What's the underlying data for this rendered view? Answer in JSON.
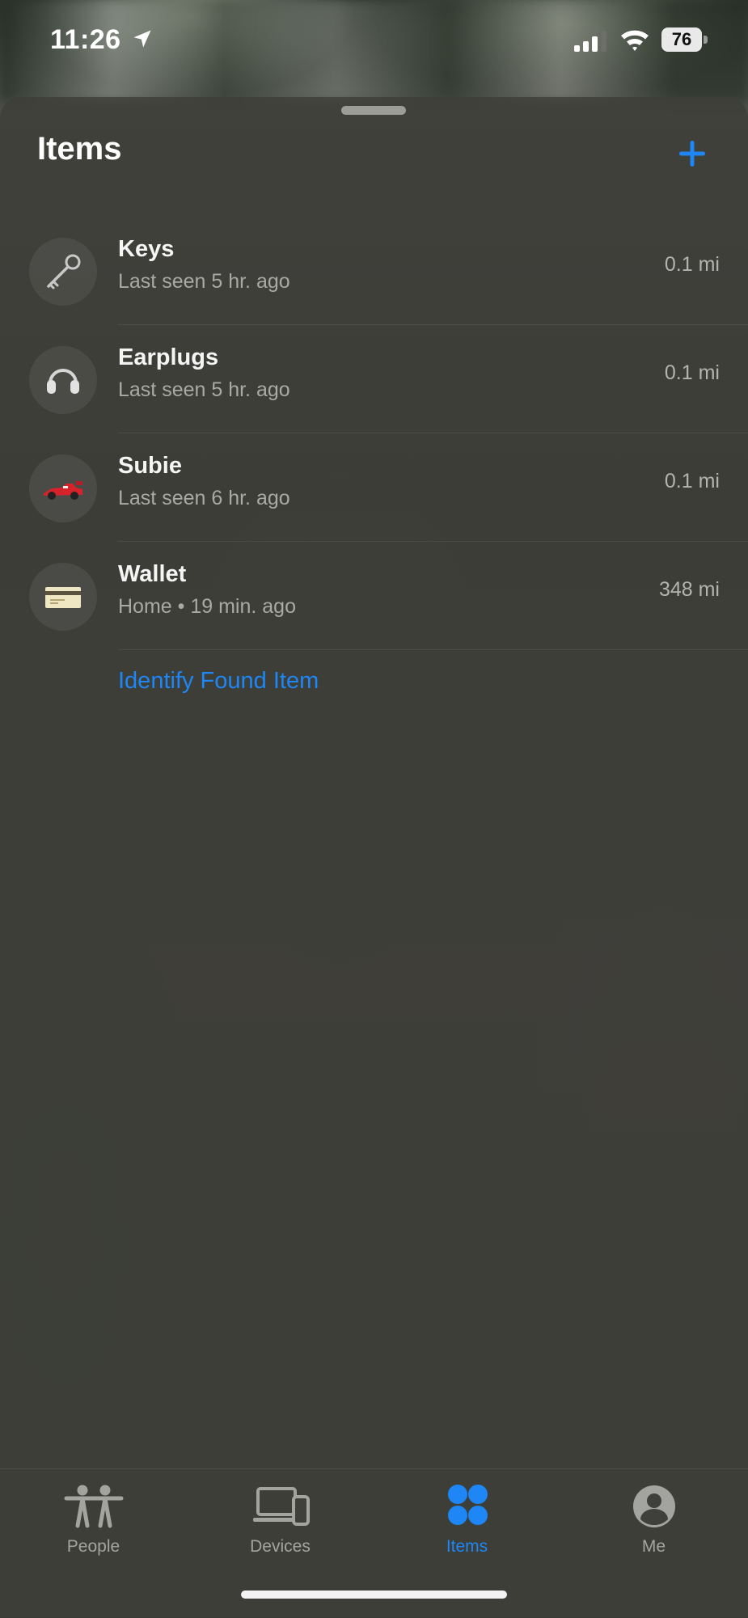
{
  "status_bar": {
    "time": "11:26",
    "battery": "76"
  },
  "sheet": {
    "title": "Items",
    "add_label": "+"
  },
  "items": [
    {
      "name": "Keys",
      "subtitle": "Last seen 5 hr. ago",
      "distance": "0.1 mi",
      "icon": "key-icon"
    },
    {
      "name": "Earplugs",
      "subtitle": "Last seen 5 hr. ago",
      "distance": "0.1 mi",
      "icon": "headphones-icon"
    },
    {
      "name": "Subie",
      "subtitle": "Last seen 6 hr. ago",
      "distance": "0.1 mi",
      "icon": "race-car-icon"
    },
    {
      "name": "Wallet",
      "subtitle": "Home • 19 min. ago",
      "distance": "348 mi",
      "icon": "credit-card-icon"
    }
  ],
  "identify_link": "Identify Found Item",
  "tabs": [
    {
      "label": "People",
      "icon": "people-icon",
      "active": false
    },
    {
      "label": "Devices",
      "icon": "devices-icon",
      "active": false
    },
    {
      "label": "Items",
      "icon": "items-icon",
      "active": true
    },
    {
      "label": "Me",
      "icon": "person-circle-icon",
      "active": false
    }
  ],
  "colors": {
    "accent": "#1e86f5",
    "sheet_background": "#3e3e39",
    "secondary_text": "#a9a9a6"
  }
}
